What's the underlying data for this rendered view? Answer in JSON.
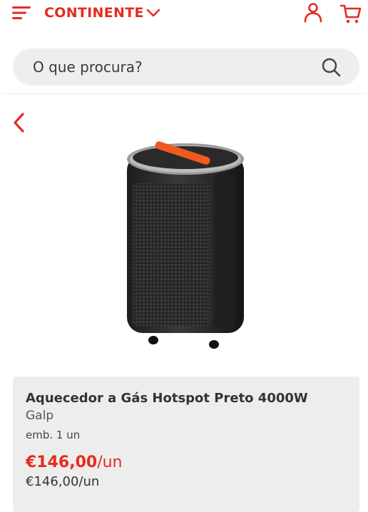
{
  "header": {
    "logo_text": "CONTINENTE",
    "menu_icon": "hamburger-menu-icon",
    "chevron_icon": "chevron-down-icon",
    "account_icon": "user-icon",
    "cart_icon": "cart-icon",
    "brand_color": "#e52b1f"
  },
  "search": {
    "placeholder": "O que procura?",
    "icon": "search-icon"
  },
  "nav": {
    "back_icon": "chevron-left-icon"
  },
  "product": {
    "title": "Aquecedor a Gás Hotspot Preto 4000W",
    "brand": "Galp",
    "package": "emb. 1 un",
    "price_value": "€146,00",
    "price_unit": "/un",
    "price_secondary": "€146,00/un",
    "image_icon": "gas-heater-image"
  }
}
